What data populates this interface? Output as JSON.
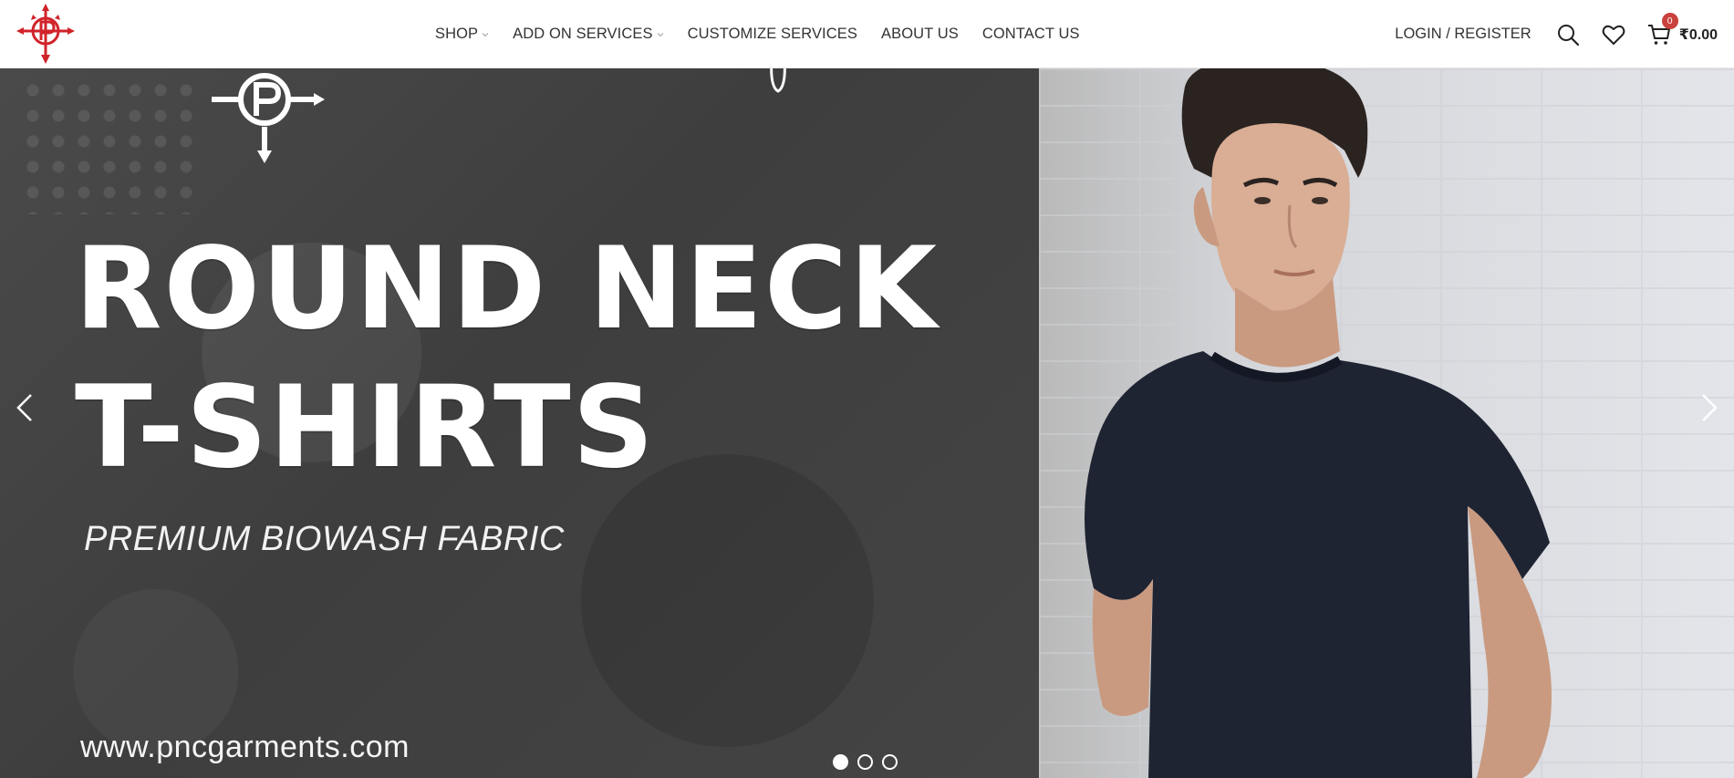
{
  "header": {
    "logo_name": "pnc-logo",
    "nav": [
      {
        "label": "SHOP",
        "has_dropdown": true
      },
      {
        "label": "ADD ON SERVICES",
        "has_dropdown": true
      },
      {
        "label": "CUSTOMIZE SERVICES",
        "has_dropdown": false
      },
      {
        "label": "ABOUT US",
        "has_dropdown": false
      },
      {
        "label": "CONTACT US",
        "has_dropdown": false
      }
    ],
    "login_label": "LOGIN / REGISTER",
    "cart": {
      "count": "0",
      "total": "₹0.00"
    },
    "accent_color": "#c9413c"
  },
  "hero": {
    "headline_line1": "ROUND NECK",
    "headline_line2": "T-SHIRTS",
    "subtitle": "PREMIUM BIOWASH FABRIC",
    "website": "www.pncgarments.com",
    "slides": 3,
    "active_slide": 1,
    "left_panel_color": "#444444",
    "tshirt_color": "#1f2433"
  }
}
